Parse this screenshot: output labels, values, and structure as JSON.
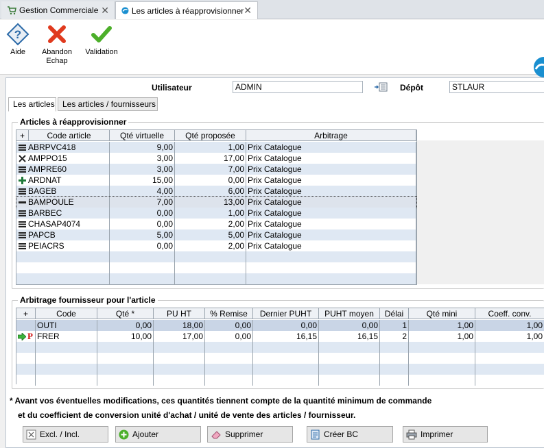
{
  "app_tabs": [
    {
      "label": "Gestion Commerciale",
      "icon": "cart-icon"
    },
    {
      "label": "Les articles à réapprovisionner",
      "icon": "app-logo-icon"
    }
  ],
  "toolbar": {
    "help_label": "Aide",
    "abandon_label": "Abandon",
    "abandon_sub": "Echap",
    "validate_label": "Validation"
  },
  "header": {
    "user_label": "Utilisateur",
    "user_value": "ADMIN",
    "depot_label": "Dépôt",
    "depot_value": "STLAUR"
  },
  "subtabs": [
    {
      "label": "Les articles",
      "active": true
    },
    {
      "label": "Les articles / fournisseurs",
      "active": false
    }
  ],
  "articles": {
    "title": "Articles à réapprovisionner",
    "columns": [
      "Code article",
      "Qté virtuelle",
      "Qté proposée",
      "Arbitrage"
    ],
    "rows": [
      {
        "icon": "stack-icon",
        "code": "ABRPVC418",
        "virt": "9,00",
        "prop": "1,00",
        "arb": "Prix Catalogue"
      },
      {
        "icon": "cross-tools-icon",
        "code": "AMPPO15",
        "virt": "3,00",
        "prop": "17,00",
        "arb": "Prix Catalogue"
      },
      {
        "icon": "stack-icon",
        "code": "AMPRE60",
        "virt": "3,00",
        "prop": "7,00",
        "arb": "Prix Catalogue"
      },
      {
        "icon": "plus-stack-icon",
        "code": "ARDNAT",
        "virt": "15,00",
        "prop": "0,00",
        "arb": "Prix Catalogue"
      },
      {
        "icon": "stack-icon",
        "code": "BAGEB",
        "virt": "4,00",
        "prop": "6,00",
        "arb": "Prix Catalogue"
      },
      {
        "icon": "flat-stack-icon",
        "code": "BAMPOULE",
        "virt": "7,00",
        "prop": "13,00",
        "arb": "Prix Catalogue"
      },
      {
        "icon": "stack-icon",
        "code": "BARBEC",
        "virt": "0,00",
        "prop": "1,00",
        "arb": "Prix Catalogue"
      },
      {
        "icon": "stack-icon",
        "code": "CHASAP4074",
        "virt": "0,00",
        "prop": "2,00",
        "arb": "Prix Catalogue"
      },
      {
        "icon": "stack-icon",
        "code": "PAPCB",
        "virt": "5,00",
        "prop": "5,00",
        "arb": "Prix Catalogue"
      },
      {
        "icon": "stack-icon",
        "code": "PEIACRS",
        "virt": "0,00",
        "prop": "2,00",
        "arb": "Prix Catalogue"
      }
    ],
    "selected_index": 5
  },
  "suppliers": {
    "title": "Arbitrage fournisseur pour l'article",
    "columns": [
      "Code",
      "Qté *",
      "PU HT",
      "% Remise",
      "Dernier PUHT",
      "PUHT moyen",
      "Délai",
      "Qté mini",
      "Coeff. conv."
    ],
    "rows": [
      {
        "code": "OUTI",
        "qte": "0,00",
        "puht": "18,00",
        "remise": "0,00",
        "dernier": "0,00",
        "moyen": "0,00",
        "delai": "1",
        "mini": "1,00",
        "coeff": "1,00",
        "selected": true
      },
      {
        "code": "FRER",
        "qte": "10,00",
        "puht": "17,00",
        "remise": "0,00",
        "dernier": "16,15",
        "moyen": "16,15",
        "delai": "2",
        "mini": "1,00",
        "coeff": "1,00",
        "selected": false
      }
    ]
  },
  "notes": {
    "line1": "* Avant vos éventuelles modifications, ces quantités tiennent compte de la quantité minimum de commande",
    "line2": "et du coefficient de conversion unité d'achat / unité de vente des articles / fournisseur."
  },
  "buttons": {
    "excl": "Excl. / Incl.",
    "add": "Ajouter",
    "delete": "Supprimer",
    "create_bc": "Créer BC",
    "print": "Imprimer"
  }
}
